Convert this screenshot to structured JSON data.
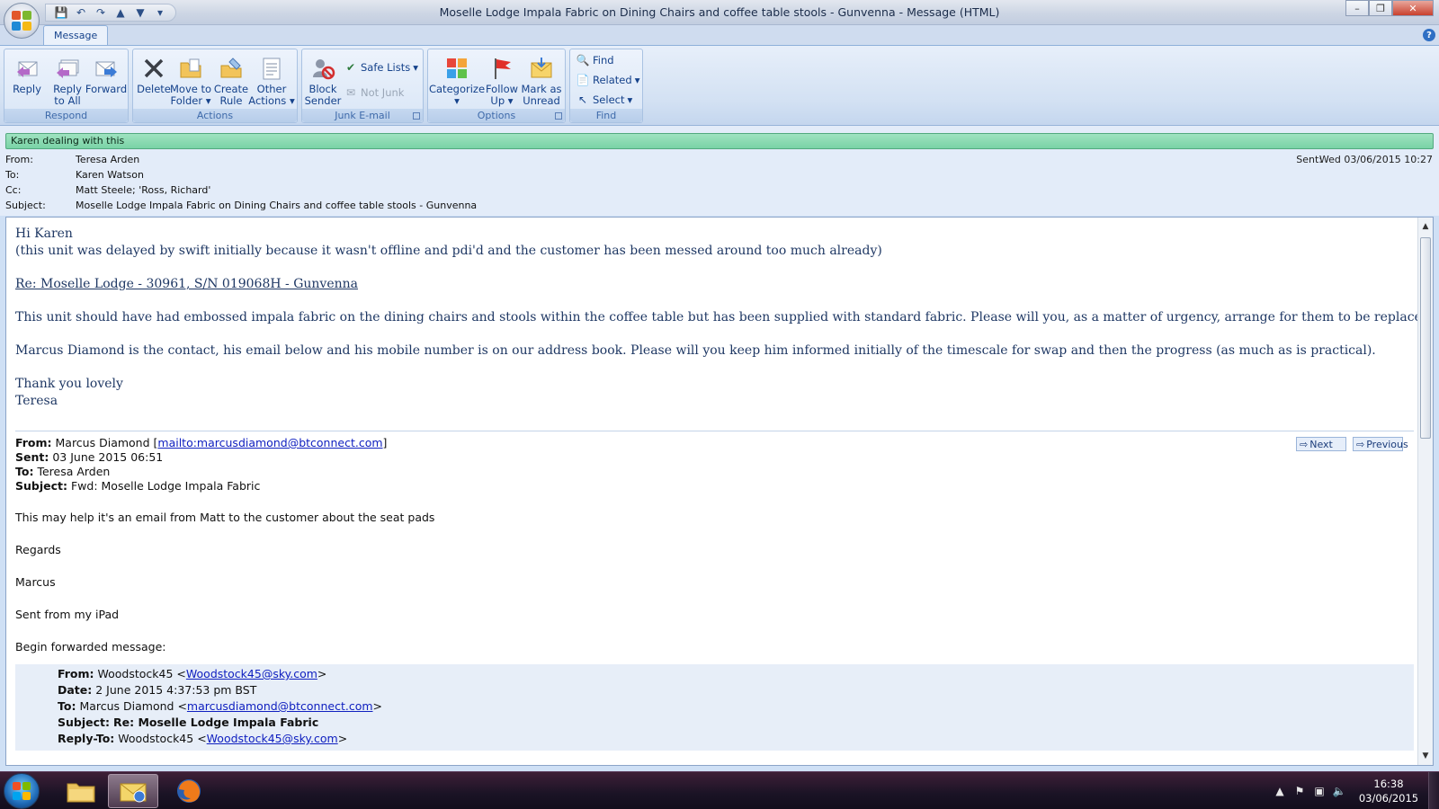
{
  "window": {
    "title": "Moselle Lodge Impala Fabric on Dining Chairs and coffee table stools - Gunvenna - Message (HTML)",
    "minimize": "–",
    "restore": "❐",
    "close": "✕"
  },
  "ribbon": {
    "tab": "Message",
    "help": "?",
    "groups": {
      "respond": "Respond",
      "actions": "Actions",
      "junk": "Junk E-mail",
      "options": "Options",
      "find": "Find"
    },
    "buttons": {
      "reply": "Reply",
      "reply_all_1": "Reply",
      "reply_all_2": "to All",
      "forward": "Forward",
      "delete": "Delete",
      "move_1": "Move to",
      "move_2": "Folder",
      "create_1": "Create",
      "create_2": "Rule",
      "other_1": "Other",
      "other_2": "Actions",
      "block_1": "Block",
      "block_2": "Sender",
      "safe_lists": "Safe Lists",
      "not_junk": "Not Junk",
      "categorize": "Categorize",
      "follow_1": "Follow",
      "follow_2": "Up",
      "mark_1": "Mark as",
      "mark_2": "Unread",
      "find": "Find",
      "related": "Related",
      "select": "Select"
    }
  },
  "header": {
    "category": "Karen dealing with this",
    "from_label": "From:",
    "from": "Teresa Arden",
    "to_label": "To:",
    "to": "Karen Watson",
    "cc_label": "Cc:",
    "cc": "Matt Steele; 'Ross, Richard'",
    "subject_label": "Subject:",
    "subject": "Moselle Lodge Impala Fabric on Dining Chairs and coffee table stools - Gunvenna",
    "sent_label": "Sent:",
    "sent": "Wed 03/06/2015 10:27"
  },
  "body": {
    "greeting": "Hi Karen",
    "note": "(this unit was delayed by swift initially because it wasn't offline and pdi'd and the customer has been messed around too much already)",
    "re_line": "Re:  Moselle Lodge - 30961, S/N 019068H - Gunvenna",
    "para1": "This unit should have had embossed impala fabric on the dining chairs and stools within the coffee table but has been supplied with standard fabric.  Please will you, as a matter of urgency, arrange for them to be replaced.",
    "para2": "Marcus Diamond is the contact, his email below and his mobile number is on our address book.  Please will you keep him informed initially of the timescale for swap and then the progress (as much as is practical).",
    "thanks": "Thank you lovely",
    "signature": "Teresa"
  },
  "quoted": {
    "from_label": "From:",
    "from_name": "Marcus Diamond [",
    "from_link": "mailto:marcusdiamond@btconnect.com",
    "from_end": "]",
    "sent_label": "Sent:",
    "sent": "03 June 2015 06:51",
    "to_label": "To:",
    "to": "Teresa Arden",
    "subject_label": "Subject:",
    "subject": "Fwd: Moselle Lodge Impala Fabric",
    "next": "Next",
    "previous": "Previous",
    "line1": "This may help it's an email from Matt to the customer about the seat pads",
    "line2": "Regards",
    "line3": "Marcus",
    "line4": "Sent from my iPad",
    "line5": "Begin forwarded message:"
  },
  "forwarded": {
    "from_label": "From:",
    "from_name": "Woodstock45 <",
    "from_link": "Woodstock45@sky.com",
    "from_end": ">",
    "date_label": "Date:",
    "date": "2 June 2015 4:37:53 pm BST",
    "to_label": "To:",
    "to_name": "Marcus Diamond <",
    "to_link": "marcusdiamond@btconnect.com",
    "to_end": ">",
    "subject_label": "Subject:",
    "subject": "Re: Moselle Lodge Impala Fabric",
    "replyto_label": "Reply-To:",
    "replyto_name": "Woodstock45 <",
    "replyto_link": "Woodstock45@sky.com",
    "replyto_end": ">"
  },
  "taskbar": {
    "time": "16:38",
    "date": "03/06/2015"
  }
}
